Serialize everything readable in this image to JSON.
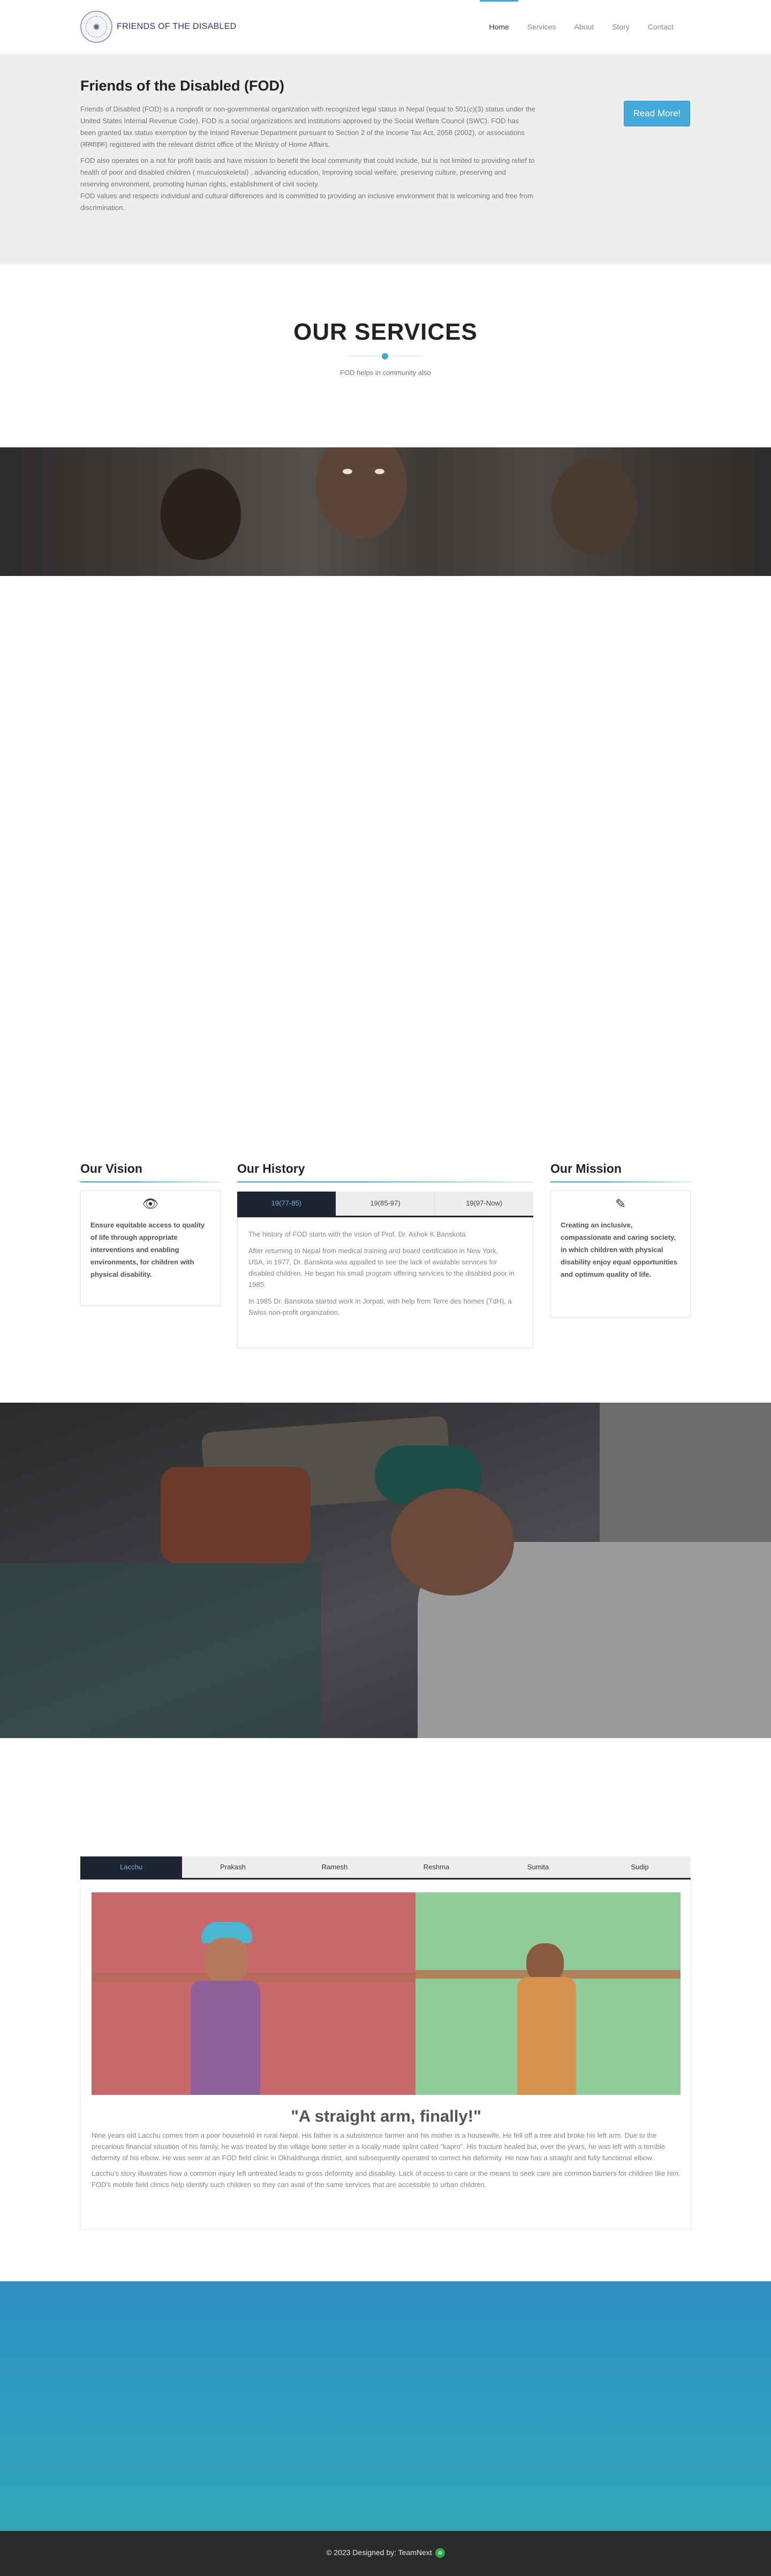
{
  "header": {
    "logo_symbol": "✺",
    "brand": "FRIENDS OF THE DISABLED",
    "nav": [
      "Home",
      "Services",
      "About",
      "Story",
      "Contact"
    ]
  },
  "intro": {
    "title": "Friends of the Disabled (FOD)",
    "p1": "Friends of Disabled (FOD) is a nonprofit or non-governmental organization with recognized legal status in Nepal (equal to 501(c)(3) status under the United States Internal Revenue Code). FOD is a social organizations and institutions approved by the Social Welfare Council (SWC). FOD has been granted tax status exemption by the Inland Revenue Department pursuant to Section 2 of the Income Tax Act, 2058 (2002), or associations (संस्थाहरू) registered with the relevant district office of the Ministry of Home Affairs.",
    "p2": "FOD also operates on a not for profit basis and have mission to benefit the local community that could include, but is not limited to providing relief to health of poor and disabled children ( musculoskeletal) , advancing education, Improving social welfare, preserving culture, preserving and reserving environment, promoting human rights, establishment of civil society.",
    "p3": "FOD values and respects individual and cultural differences and is committed to providing an inclusive environment that is welcoming and free from discrimination.",
    "button": "Read More!"
  },
  "services": {
    "title": "OUR SERVICES",
    "subtitle": "FOD helps in community also"
  },
  "vision": {
    "title": "Our Vision",
    "icon": "eye-icon",
    "glyph": "👁",
    "text": "Ensure equitable access to quality of life through appropriate interventions and enabling environments, for children with physical disability."
  },
  "history": {
    "title": "Our History",
    "tabs": [
      "19(77-85)",
      "19(85-97)",
      "19(97-Now)"
    ],
    "p1": "The history of FOD starts with the vision of Prof. Dr. Ashok K Banskota.",
    "p2": "After returning to Nepal from medical training and board certification in New York, USA, in 1977, Dr. Banskota was appalled to see the lack of available services for disabled children. He began his small program offering services to the disabled poor in 1985.",
    "p3": "In 1985 Dr. Banskota started work in Jorpati, with help from Terre des homes (TdH), a Swiss non-profit organization."
  },
  "mission": {
    "title": "Our Mission",
    "icon": "pencil-icon",
    "glyph": "✎",
    "text": "Creating an inclusive, compassionate and caring society, in which children with physical disability enjoy equal opportunities and optimum quality of life."
  },
  "stories": {
    "tabs": [
      "Lacchu",
      "Prakash",
      "Ramesh",
      "Reshma",
      "Sumita",
      "Sudip"
    ],
    "heading": "\"A straight arm, finally!\"",
    "p1": "Nine years old Lacchu comes from a poor household in rural Nepal. His father is a subsistence farmer and his mother is a housewife. He fell off a tree and broke his left arm. Due to the precarious financial situation of his family, he was treated by the village bone setter in a locally made splint called \"kapro\". His fracture healed but, over the years, he was left with a terrible deformity of his elbow. He was seen at an FOD field clinic in Okhaldhunga district, and subsequently operated to correct his deformity. He now has a straight and fully functional elbow.",
    "p2": "Lacchu's story illustrates how a common injury left untreated leads to gross deformity and disability. Lack of access to care or the means to seek care are common barriers for children like him. FOD's mobile field clinics help identify such children so they can avail of the same services that are accessible to urban children."
  },
  "footer": {
    "text": "© 2023 Designed by: TeamNext"
  },
  "colors": {
    "accent": "#45a9cf",
    "dark": "#1f2433",
    "footer": "#2b2b2b",
    "band": "#2f9fc0"
  }
}
